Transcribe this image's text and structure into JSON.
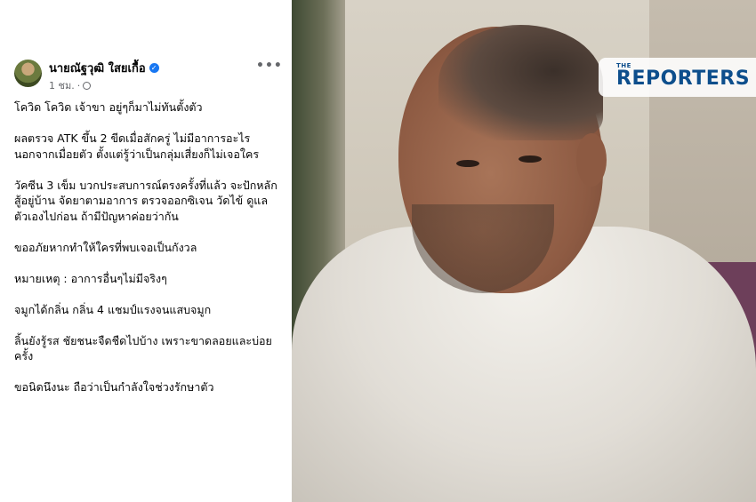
{
  "post": {
    "author": "นายณัฐวุฒิ  ใสยเกื้อ",
    "verified_icon": "verified-badge-icon",
    "time": "1 ชม.",
    "separator": "·",
    "privacy_icon": "globe-icon",
    "more_label": "•••",
    "paragraphs": [
      "โควิด โควิด เจ้าขา อยู่ๆก็มาไม่ทันตั้งตัว",
      "ผลตรวจ ATK ขึ้น 2 ขีดเมื่อสักครู่ ไม่มีอาการอะไร นอกจากเมื่อยตัว ตั้งแต่รู้ว่าเป็นกลุ่มเสี่ยงก็ไม่เจอใคร",
      "วัคซีน 3 เข็ม บวกประสบการณ์ตรงครั้งที่แล้ว จะปักหลักสู้อยู่บ้าน จัดยาตามอาการ ตรวจออกซิเจน วัดไข้ ดูแลตัวเองไปก่อน ถ้ามีปัญหาค่อยว่ากัน",
      "ขออภัยหากทำให้ใครที่พบเจอเป็นกังวล",
      "หมายเหตุ : อาการอื่นๆไม่มีจริงๆ",
      "จมูกได้กลิ่น กลิ่น 4 แชมป์แรงจนแสบจมูก",
      "ลิ้นยังรู้รส ชัยชนะจืดชืดไปบ้าง เพราะขาดลอยและบ่อยครั้ง",
      "ขอนิดนึงนะ ถือว่าเป็นกำลังใจช่วงรักษาตัว"
    ]
  },
  "photo": {
    "watermark_small": "THE",
    "watermark_main": "REPORTERS"
  }
}
